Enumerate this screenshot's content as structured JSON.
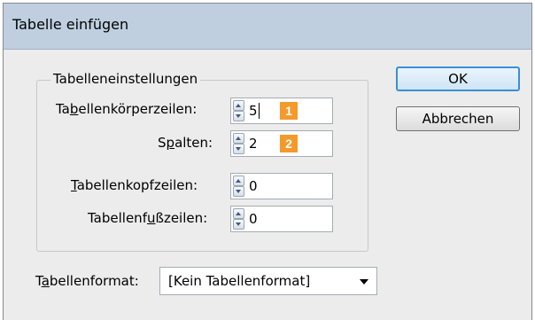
{
  "window": {
    "title": "Tabelle einfügen"
  },
  "group": {
    "label": "Tabelleneinstellungen"
  },
  "fields": {
    "body_rows": {
      "label_pre": "Ta",
      "label_ul": "b",
      "label_post": "ellenkörperzeilen:",
      "value": "5",
      "badge": "1"
    },
    "columns": {
      "label_pre": "S",
      "label_ul": "p",
      "label_post": "alten:",
      "value": "2",
      "badge": "2"
    },
    "header_rows": {
      "label_pre": "",
      "label_ul": "T",
      "label_post": "abellenkopfzeilen:",
      "value": "0"
    },
    "footer_rows": {
      "label_pre": "Tabellenf",
      "label_ul": "u",
      "label_post": "ßzeilen:",
      "value": "0"
    }
  },
  "table_style": {
    "label_pre": "T",
    "label_ul": "a",
    "label_post": "bellenformat:",
    "selected": "[Kein Tabellenformat]"
  },
  "buttons": {
    "ok": "OK",
    "cancel": "Abbrechen"
  },
  "colors": {
    "badge": "#f39a2b",
    "titlebar": "#bfcfe0",
    "default_button_border": "#3a8fd4"
  }
}
